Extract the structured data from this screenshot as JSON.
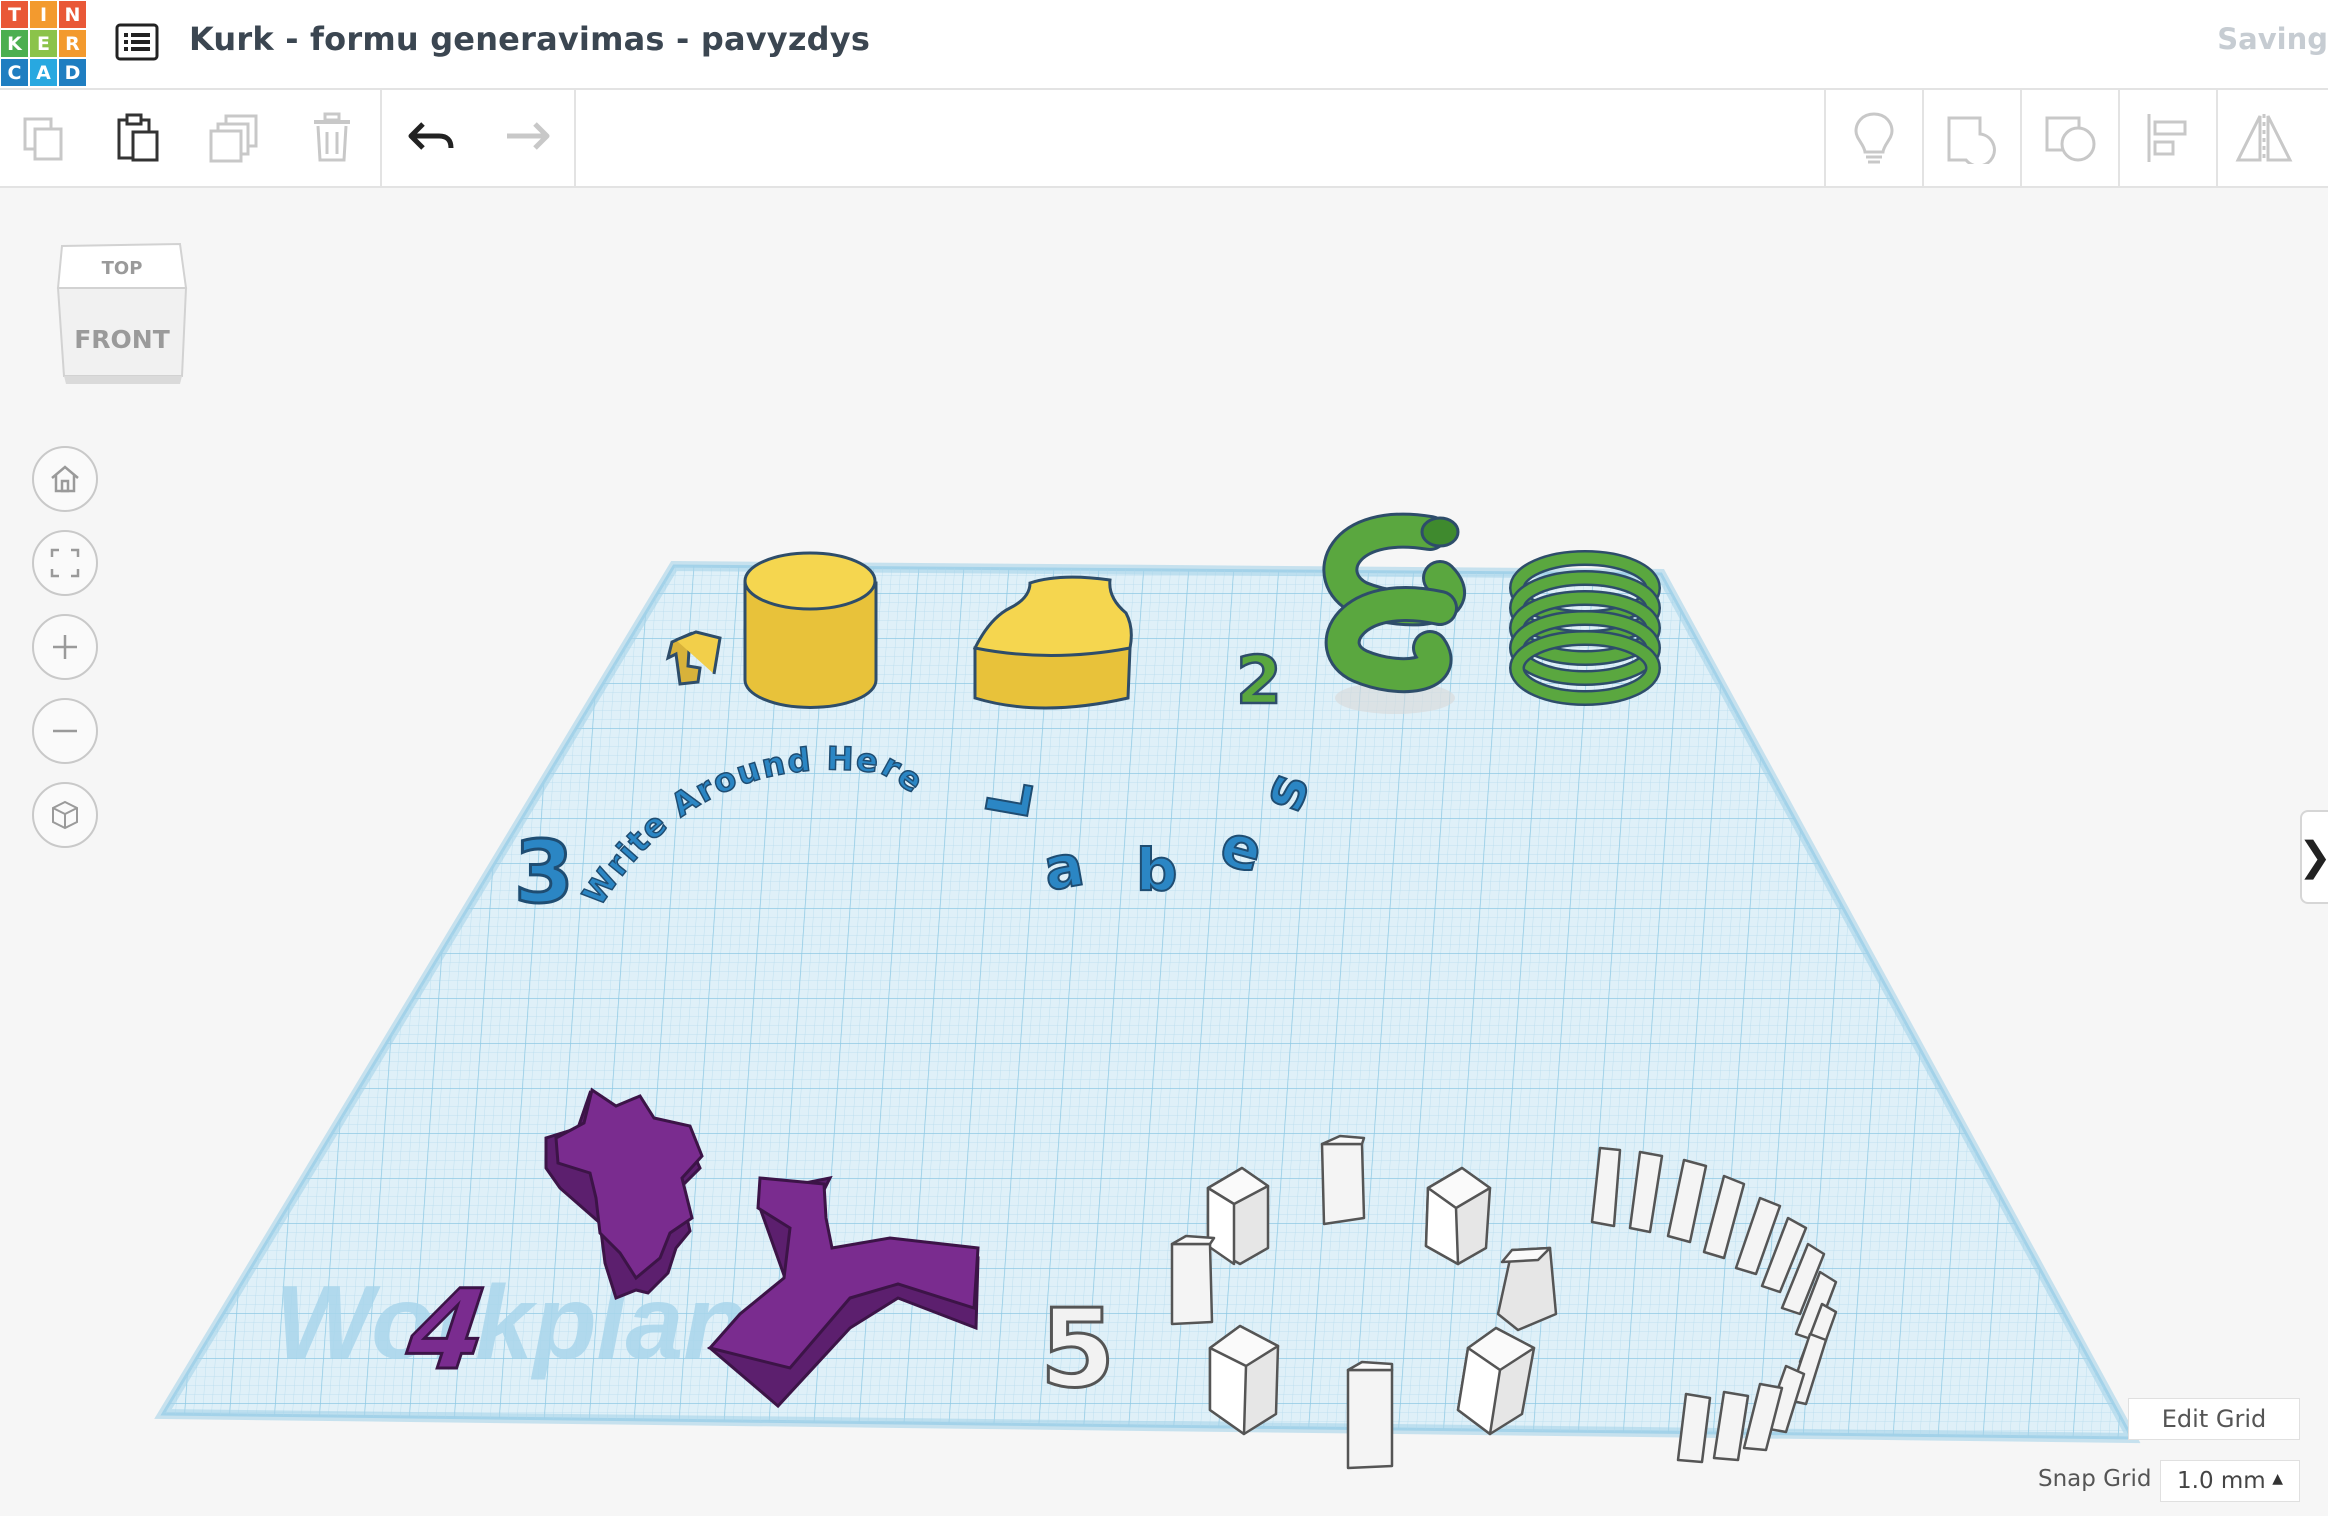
{
  "app": {
    "logo_letters": [
      "T",
      "I",
      "N",
      "K",
      "E",
      "R",
      "C",
      "A",
      "D"
    ],
    "logo_colors": [
      "#e95837",
      "#f39a2e",
      "#e95837",
      "#4caf50",
      "#8bc34a",
      "#f39a2e",
      "#1f7ec1",
      "#28a8e0",
      "#1f7ec1"
    ]
  },
  "header": {
    "title": "Kurk - formu generavimas - pavyzdys",
    "status": "Saving",
    "menu_icon": "list-icon"
  },
  "toolbar": {
    "left_tools": [
      "copy-icon",
      "paste-icon",
      "duplicate-icon",
      "delete-icon",
      "undo-icon",
      "redo-icon"
    ],
    "right_tools": [
      "lightbulb-icon",
      "group-icon",
      "ungroup-icon",
      "align-icon",
      "mirror-icon"
    ]
  },
  "viewcube": {
    "top_label": "TOP",
    "front_label": "FRONT"
  },
  "nav_controls": [
    "home-icon",
    "fit-all-icon",
    "zoom-in-icon",
    "zoom-out-icon",
    "perspective-icon"
  ],
  "workplane": {
    "watermark": "Workplane",
    "labels": {
      "one": "1",
      "two": "2",
      "three": "3",
      "four": "4",
      "five": "5"
    },
    "curved_text": "Write Around Here",
    "scattered_letters": [
      "L",
      "a",
      "b",
      "e",
      "s"
    ]
  },
  "bottom": {
    "edit_grid": "Edit Grid",
    "snap_label": "Snap Grid",
    "snap_value": "1.0 mm"
  },
  "colors": {
    "yellow": "#f2cf4a",
    "green": "#4e9a3c",
    "blue": "#2b86c4",
    "purple": "#7a2c8f",
    "white_shape": "#f4f4f4",
    "grid": "#cde8f4"
  }
}
